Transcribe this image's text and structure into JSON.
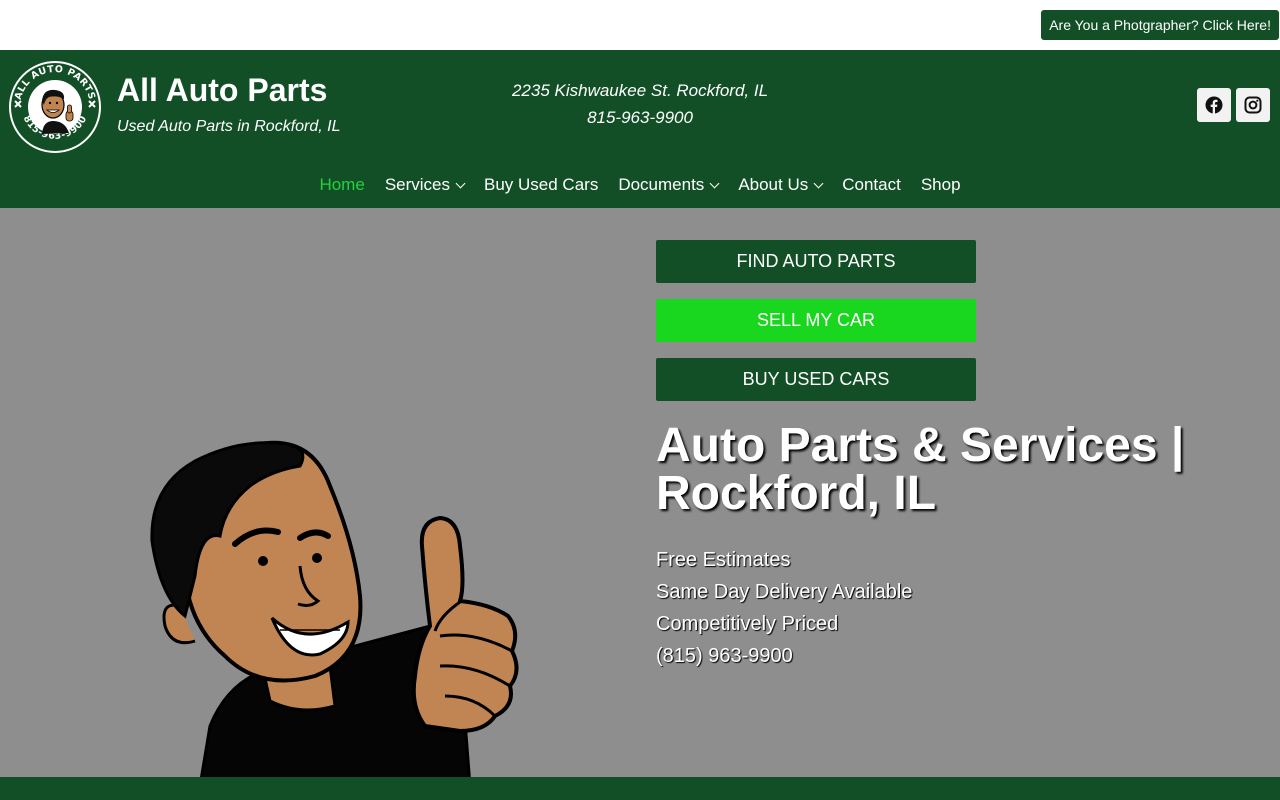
{
  "topbar": {
    "photographer_button": "Are You a Photgrapher? Click Here!"
  },
  "header": {
    "logo": {
      "ring_text_top": "ALL AUTO PARTS",
      "ring_text_bottom": "815-963-9900"
    },
    "site_title": "All Auto Parts",
    "tagline": "Used Auto Parts in Rockford, IL",
    "address": "2235 Kishwaukee St. Rockford, IL",
    "phone": "815-963-9900",
    "social": [
      {
        "icon": "facebook-icon"
      },
      {
        "icon": "instagram-icon"
      }
    ]
  },
  "nav": {
    "items": [
      {
        "label": "Home",
        "active": true
      },
      {
        "label": "Services",
        "dropdown": true
      },
      {
        "label": "Buy Used Cars"
      },
      {
        "label": "Documents",
        "dropdown": true
      },
      {
        "label": "About Us",
        "dropdown": true
      },
      {
        "label": "Contact"
      },
      {
        "label": "Shop"
      }
    ]
  },
  "hero": {
    "buttons": {
      "find_parts": "FIND AUTO PARTS",
      "sell_car": "SELL MY CAR",
      "buy_cars": "BUY USED CARS"
    },
    "title": "Auto Parts & Services | Rockford, IL",
    "features": [
      "Free Estimates",
      "Same Day Delivery Available",
      "Competitively Priced",
      "(815) 963-9900"
    ]
  },
  "colors": {
    "brand_green": "#124f26",
    "bright_green": "#19d61e",
    "active_nav": "#23d13f",
    "hero_bg": "#8e8e8e"
  }
}
